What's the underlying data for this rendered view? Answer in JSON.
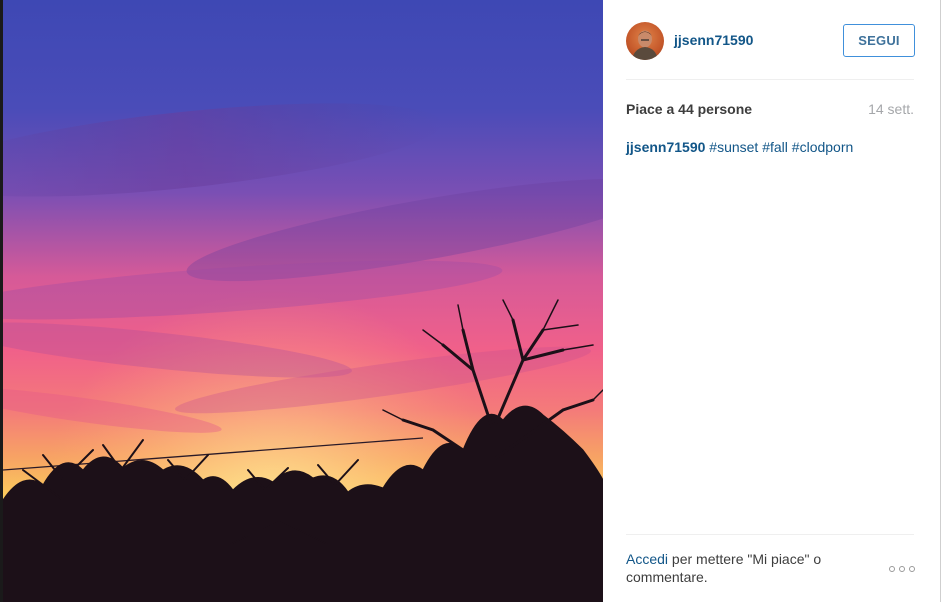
{
  "post": {
    "username": "jjsenn71590",
    "follow_label": "SEGUI",
    "likes_text": "Piace a 44 persone",
    "time_ago": "14 sett.",
    "caption": {
      "author": "jjsenn71590",
      "hashtags": [
        "#sunset",
        "#fall",
        "#clodporn"
      ]
    },
    "footer": {
      "login_link": "Accedi",
      "login_text": " per mettere \"Mi piace\" o commentare."
    }
  },
  "icons": {
    "more_options": "ellipsis-icon",
    "avatar": "user-avatar"
  },
  "colors": {
    "link": "#125688",
    "follow_border": "#4090db",
    "meta_text": "#a5a7aa"
  }
}
